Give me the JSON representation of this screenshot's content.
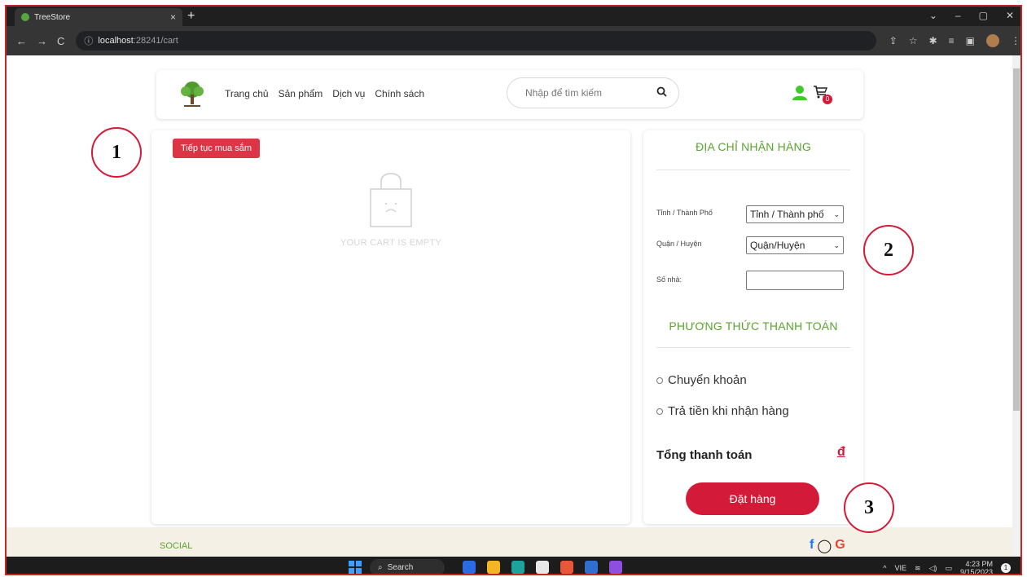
{
  "browser": {
    "tab_title": "TreeStore",
    "tab_close": "×",
    "new_tab": "+",
    "url_host": "localhost",
    "url_path": ":28241/cart",
    "nav_back": "←",
    "nav_forward": "→",
    "nav_reload": "C",
    "win_minimize": "–",
    "win_restore": "▢",
    "win_close": "✕",
    "tab_list": "⌄"
  },
  "header": {
    "menu": [
      "Trang chủ",
      "Sản phẩm",
      "Dịch vụ",
      "Chính sách"
    ],
    "search_placeholder": "Nhập để tìm kiếm",
    "cart_count": "0"
  },
  "cart": {
    "continue_label": "Tiếp tục mua sắm",
    "empty_text": "YOUR CART IS EMPTY"
  },
  "shipping": {
    "title": "ĐỊA CHỈ NHẬN HÀNG",
    "province_label": "Tỉnh / Thành Phố",
    "province_value": "Tỉnh / Thành phố",
    "district_label": "Quận / Huyện",
    "district_value": "Quận/Huyện",
    "address_label": "Số nhà:",
    "address_value": ""
  },
  "payment": {
    "title": "PHƯƠNG THỨC THANH TOÁN",
    "options": [
      "Chuyển khoản",
      "Trả tiền khi nhận hàng"
    ],
    "total_label": "Tổng thanh toán",
    "currency": "đ",
    "order_label": "Đặt hàng"
  },
  "footer": {
    "social_label": "SOCIAL"
  },
  "annotations": [
    "1",
    "2",
    "3"
  ],
  "taskbar": {
    "search_label": "Search",
    "lang": "VIE",
    "time": "4:23 PM",
    "date": "9/15/2023",
    "notification_count": "1"
  },
  "colors": {
    "accent_green": "#5ba32f",
    "accent_red": "#d31a38",
    "button_red": "#dc3545"
  }
}
